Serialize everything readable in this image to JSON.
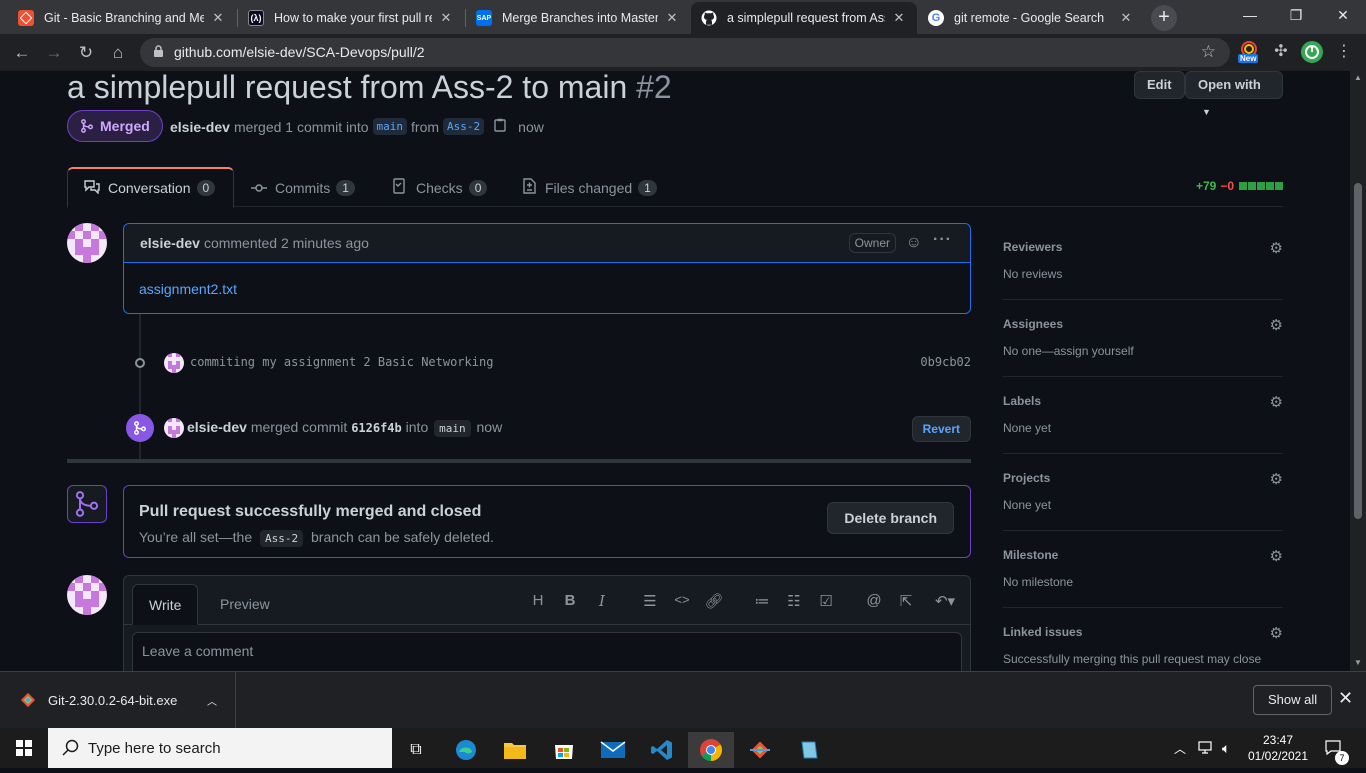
{
  "browser": {
    "tabs": [
      {
        "title": "Git - Basic Branching and Merg",
        "favicon_color": "#f05133"
      },
      {
        "title": "How to make your first pull re",
        "favicon_color": "#0a0a23"
      },
      {
        "title": "Merge Branches into Master B",
        "favicon_color": "#0070f2"
      },
      {
        "title": "a simplepull request from Ass-",
        "favicon_color": "#ffffff"
      },
      {
        "title": "git remote - Google Search",
        "favicon_color": "#4285f4"
      }
    ],
    "url": "github.com/elsie-dev/SCA-Devops/pull/2",
    "ext_new_badge": "New"
  },
  "pr": {
    "title": "a simplepull request from Ass-2 to main",
    "number": "#2",
    "edit_label": "Edit",
    "open_with_label": "Open with",
    "state_label": "Merged",
    "author": "elsie-dev",
    "meta_merged": "merged 1 commit into",
    "base_branch": "main",
    "from_word": "from",
    "head_branch": "Ass-2",
    "meta_time": "now"
  },
  "tabs": [
    {
      "label": "Conversation",
      "count": "0"
    },
    {
      "label": "Commits",
      "count": "1"
    },
    {
      "label": "Checks",
      "count": "0"
    },
    {
      "label": "Files changed",
      "count": "1"
    }
  ],
  "diffstat": {
    "additions": "+79",
    "deletions": "−0"
  },
  "comment": {
    "author": "elsie-dev",
    "action": "commented 2 minutes ago",
    "role": "Owner",
    "body_link": "assignment2.txt"
  },
  "commit": {
    "message": "commiting my assignment 2 Basic Networking",
    "sha": "0b9cb02"
  },
  "merge_event": {
    "author": "elsie-dev",
    "text1": "merged commit",
    "commit": "6126f4b",
    "text2": "into",
    "branch": "main",
    "time": "now",
    "revert_label": "Revert"
  },
  "merged_box": {
    "heading": "Pull request successfully merged and closed",
    "text_before": "You’re all set—the",
    "branch": "Ass-2",
    "text_after": "branch can be safely deleted.",
    "button": "Delete branch"
  },
  "editor": {
    "write_tab": "Write",
    "preview_tab": "Preview",
    "placeholder": "Leave a comment"
  },
  "sidebar": [
    {
      "title": "Reviewers",
      "value": "No reviews"
    },
    {
      "title": "Assignees",
      "value": "No one—assign yourself"
    },
    {
      "title": "Labels",
      "value": "None yet"
    },
    {
      "title": "Projects",
      "value": "None yet"
    },
    {
      "title": "Milestone",
      "value": "No milestone"
    },
    {
      "title": "Linked issues",
      "value": "Successfully merging this pull request may close"
    }
  ],
  "download": {
    "filename": "Git-2.30.0.2-64-bit.exe",
    "show_all": "Show all"
  },
  "taskbar": {
    "search_placeholder": "Type here to search",
    "time": "23:47",
    "date": "01/02/2021",
    "notification_count": "7"
  },
  "colors": {
    "merged_purple": "#8957e5",
    "link_blue": "#58a6ff",
    "page_bg": "#0d1117",
    "add_green": "#3fb950"
  }
}
